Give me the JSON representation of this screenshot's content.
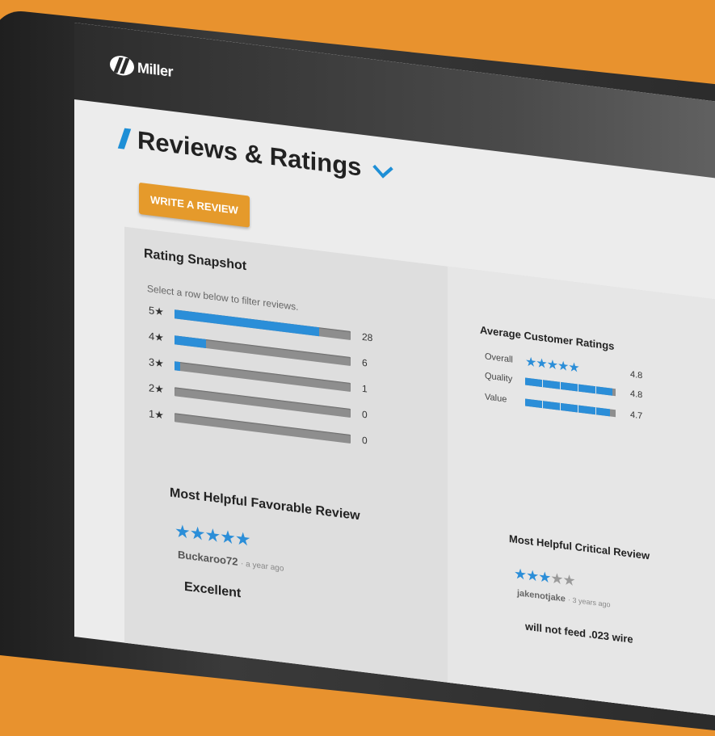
{
  "brand": {
    "name": "Miller"
  },
  "page": {
    "title": "Reviews & Ratings"
  },
  "actions": {
    "write_review_label": "WRITE A REVIEW"
  },
  "snapshot": {
    "title": "Rating Snapshot",
    "hint": "Select a row below to filter reviews.",
    "rows": [
      {
        "label": "5★",
        "count": "28",
        "fill": 0.82
      },
      {
        "label": "4★",
        "count": "6",
        "fill": 0.18
      },
      {
        "label": "3★",
        "count": "1",
        "fill": 0.03
      },
      {
        "label": "2★",
        "count": "0",
        "fill": 0
      },
      {
        "label": "1★",
        "count": "0",
        "fill": 0
      }
    ]
  },
  "average": {
    "title": "Average Customer Ratings",
    "overall": {
      "label": "Overall",
      "stars": "★★★★★",
      "value": "4.8"
    },
    "quality": {
      "label": "Quality",
      "value": "4.8",
      "fill": 0.96
    },
    "value_rating": {
      "label": "Value",
      "value": "4.7",
      "fill": 0.94
    }
  },
  "favorable": {
    "title": "Most Helpful Favorable Review",
    "stars": "★★★★★",
    "user": "Buckaroo72",
    "ago": "· a year ago",
    "headline": "Excellent"
  },
  "critical": {
    "title": "Most Helpful Critical Review",
    "stars_on": "★★★",
    "stars_off": "★★",
    "user": "jakenotjake",
    "ago": "· 3 years ago",
    "headline": "will not feed .023 wire"
  },
  "colors": {
    "accent": "#2b8ed8",
    "button": "#e59a2b",
    "frame": "#e8922e"
  }
}
